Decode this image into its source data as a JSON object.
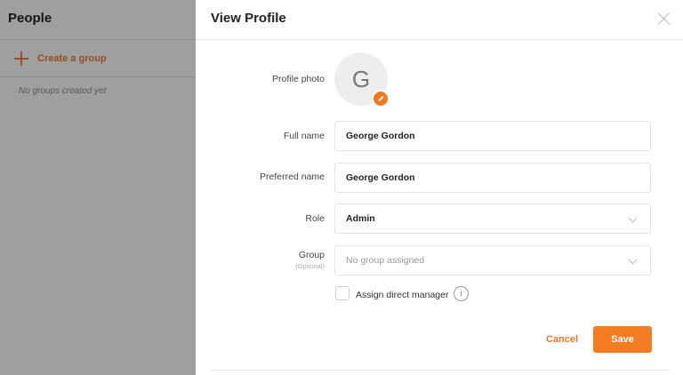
{
  "sidebar": {
    "title": "People",
    "create_group_label": "Create a group",
    "empty_text": "No groups created yet"
  },
  "modal": {
    "title": "View Profile",
    "profile_photo_label": "Profile photo",
    "avatar_initial": "G",
    "full_name_label": "Full name",
    "full_name_value": "George Gordon",
    "preferred_name_label": "Preferred name",
    "preferred_name_value": "George Gordon",
    "role_label": "Role",
    "role_value": "Admin",
    "group_label": "Group",
    "group_optional": "(Optional)",
    "group_value": "No group assigned",
    "assign_manager_label": "Assign direct manager",
    "info_glyph": "i",
    "cancel_label": "Cancel",
    "save_label": "Save"
  },
  "colors": {
    "accent": "#f47c23",
    "accent_text": "#e8772e"
  }
}
